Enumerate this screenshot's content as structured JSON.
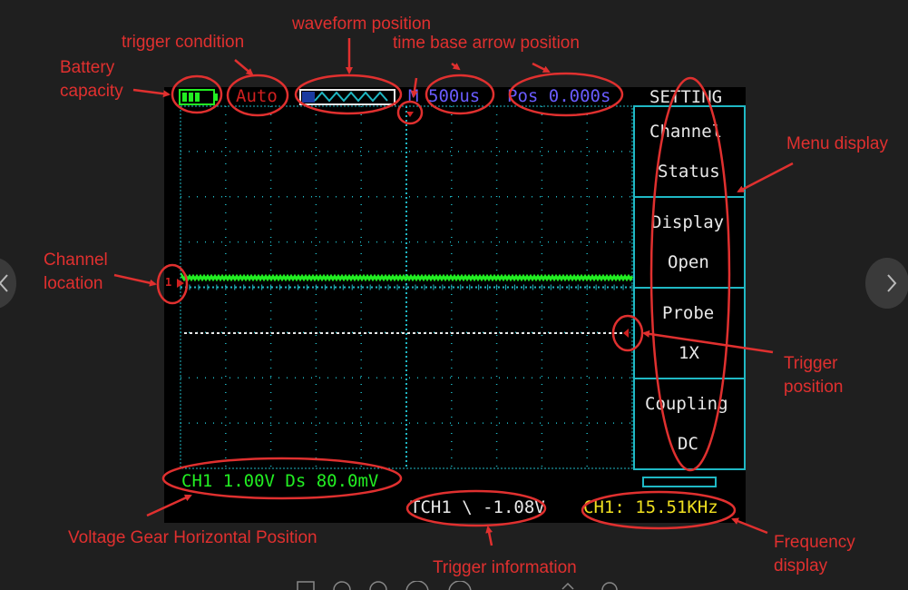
{
  "scope": {
    "top_bar": {
      "trigger_mode": "Auto",
      "m_label": "M",
      "time_base": "500us",
      "position": "Pos 0.000s",
      "menu_title": "SETTING"
    },
    "menu": [
      {
        "line1": "Channel",
        "line2": "Status"
      },
      {
        "line1": "Display",
        "line2": "Open"
      },
      {
        "line1": "Probe",
        "line2": "1X"
      },
      {
        "line1": "Coupling",
        "line2": "DC"
      }
    ],
    "channel_marker": "1",
    "bottom": {
      "voltage_info": "CH1 1.00V  Ds  80.0mV",
      "trigger_info": "TCH1 \\ -1.08V",
      "frequency": "CH1:  15.51KHz"
    }
  },
  "annotations": {
    "battery_capacity": [
      "Battery",
      "capacity"
    ],
    "trigger_condition": "trigger condition",
    "waveform_position": "waveform position",
    "time_base_arrow_position": "time base arrow position",
    "menu_display": "Menu display",
    "channel_location": [
      "Channel",
      "location"
    ],
    "trigger_position": [
      "Trigger",
      "position"
    ],
    "voltage_gear": "Voltage Gear Horizontal Position",
    "trigger_information": "Trigger information",
    "frequency_display": [
      "Frequency",
      "display"
    ]
  },
  "colors": {
    "background": "#1f1f1f",
    "screen": "#000000",
    "grid": "#1fb8c4",
    "trace": "#22ee22",
    "annotation": "#e0302f",
    "menu_text": "#e8e8e8",
    "status_blue": "#6a5cff",
    "status_red": "#d02020",
    "yellow_text": "#f0e020",
    "green_text": "#22ee22",
    "battery": "#22ee22"
  }
}
